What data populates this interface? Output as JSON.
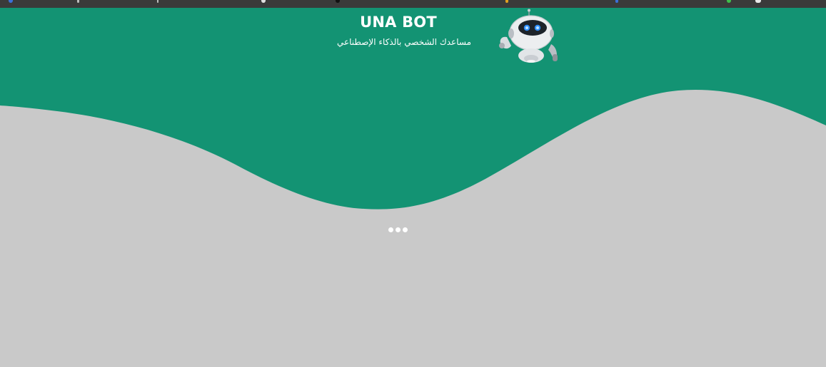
{
  "app": {
    "title": "UNA BOT",
    "subtitle": "مساعدك الشخصي بالذكاء الإصطناعي"
  },
  "status": {
    "typing_indicator": "bot-typing-dots"
  },
  "colors": {
    "header_green": "#139373",
    "page_background": "#c9c9c9",
    "browser_bar": "#3a3a3a",
    "text_white": "#ffffff"
  },
  "icons": {
    "logo": "robot-mascot-icon",
    "typing": "three-dots-icon"
  }
}
